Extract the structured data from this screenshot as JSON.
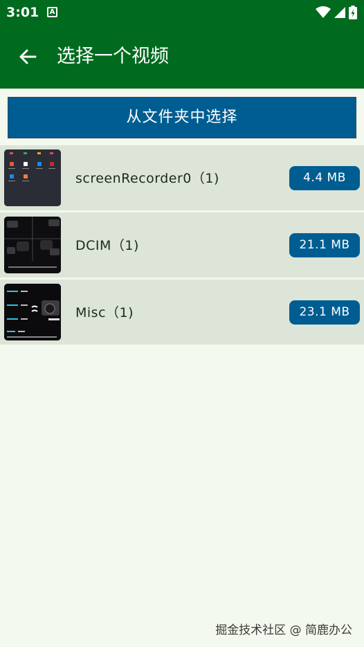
{
  "status": {
    "time": "3:01",
    "notification_glyph": "A",
    "icons": [
      "wifi-icon",
      "signal-icon",
      "battery-icon"
    ]
  },
  "app_bar": {
    "title": "选择一个视频",
    "back_icon": "arrow-back-icon"
  },
  "folder_button": {
    "label": "从文件夹中选择"
  },
  "folders": [
    {
      "name": "screenRecorder0（1)",
      "size": "4.4 MB",
      "thumb_icon": "phone-screen-thumbnail"
    },
    {
      "name": "DCIM（1)",
      "size": "21.1 MB",
      "thumb_icon": "camera-grid-thumbnail"
    },
    {
      "name": "Misc（1)",
      "size": "23.1 MB",
      "thumb_icon": "lens-comparison-thumbnail"
    }
  ],
  "watermark": "掘金技术社区 @ 简鹿办公",
  "colors": {
    "app_bar": "#006b1e",
    "primary_button": "#005d92",
    "row_bg": "#dce5d8",
    "page_bg": "#f3f9ee"
  }
}
